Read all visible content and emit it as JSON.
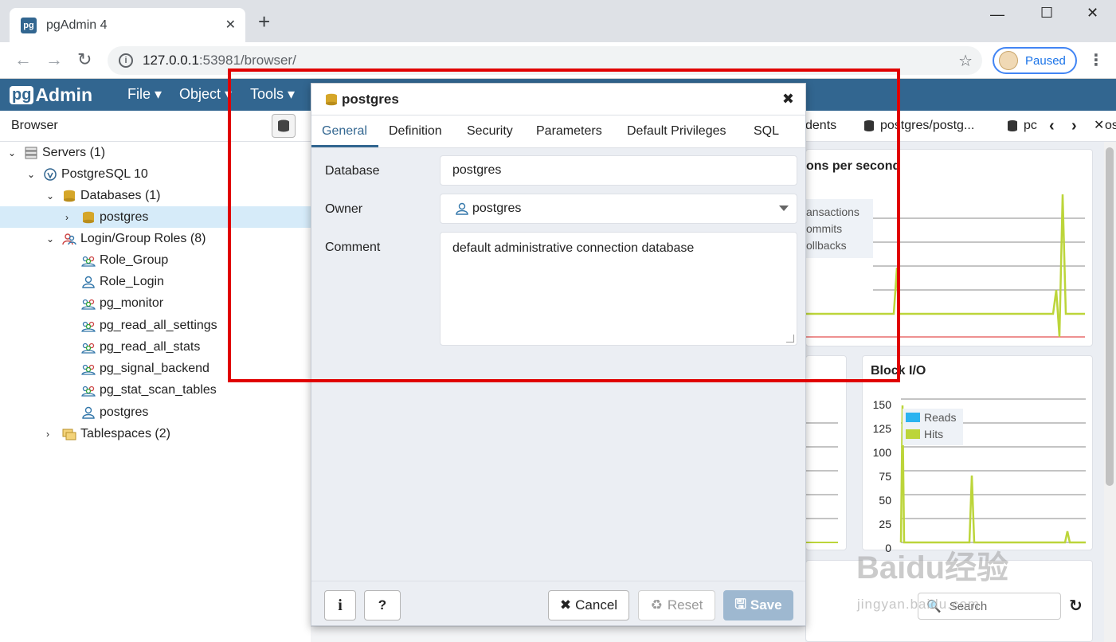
{
  "chrome": {
    "tab_title": "pgAdmin 4",
    "tab_favicon": "pg",
    "url_host": "127.0.0.1",
    "url_rest": ":53981/browser/",
    "profile_label": "Paused"
  },
  "pgadmin": {
    "logo_pg": "pg",
    "logo_admin": "Admin",
    "menus": [
      "File ▾",
      "Object ▾",
      "Tools ▾"
    ]
  },
  "browser": {
    "title": "Browser",
    "tree": [
      {
        "label": "Servers (1)",
        "icon": "servers-icon",
        "chev": "⌄"
      },
      {
        "label": "PostgreSQL 10",
        "icon": "postgres-elephant-icon",
        "chev": "⌄"
      },
      {
        "label": "Databases (1)",
        "icon": "databases-icon",
        "chev": "⌄"
      },
      {
        "label": "postgres",
        "icon": "database-icon",
        "chev": "›"
      },
      {
        "label": "Login/Group Roles (8)",
        "icon": "group-roles-icon",
        "chev": "⌄"
      },
      {
        "label": "Role_Group",
        "icon": "group-role-icon"
      },
      {
        "label": "Role_Login",
        "icon": "login-role-icon"
      },
      {
        "label": "pg_monitor",
        "icon": "group-role-icon"
      },
      {
        "label": "pg_read_all_settings",
        "icon": "group-role-icon"
      },
      {
        "label": "pg_read_all_stats",
        "icon": "group-role-icon"
      },
      {
        "label": "pg_signal_backend",
        "icon": "group-role-icon"
      },
      {
        "label": "pg_stat_scan_tables",
        "icon": "group-role-icon"
      },
      {
        "label": "postgres",
        "icon": "login-role-icon"
      },
      {
        "label": "Tablespaces (2)",
        "icon": "tablespaces-icon",
        "chev": "›"
      }
    ]
  },
  "dashboard": {
    "tabs": [
      "dents",
      "postgres/postg...",
      "pc"
    ],
    "tab_extra": "ostg",
    "tps_title": "ons per second",
    "tps_legend": [
      "ansactions",
      "ommits",
      "ollbacks"
    ],
    "blockio_title": "Block I/O",
    "blockio_yticks": [
      "150",
      "125",
      "100",
      "75",
      "50",
      "25",
      "0"
    ],
    "blockio_legend": [
      {
        "name": "Reads",
        "color": "#2bb3f0"
      },
      {
        "name": "Hits",
        "color": "#bcd53a"
      }
    ],
    "search_label": "Search",
    "watermark": "Baidu经验",
    "watermark_sub": "jingyan.baidu.com"
  },
  "dialog": {
    "title": "postgres",
    "tabs": [
      "General",
      "Definition",
      "Security",
      "Parameters",
      "Default Privileges",
      "SQL"
    ],
    "fields": {
      "database_label": "Database",
      "database_value": "postgres",
      "owner_label": "Owner",
      "owner_value": "postgres",
      "comment_label": "Comment",
      "comment_value": "default administrative connection database"
    },
    "buttons": {
      "info": "i",
      "help": "?",
      "cancel": "Cancel",
      "reset": "Reset",
      "save": "Save"
    }
  },
  "colors": {
    "pgadmin_blue": "#326690",
    "highlight": "#e00000",
    "series_hits": "#bcd53a"
  }
}
